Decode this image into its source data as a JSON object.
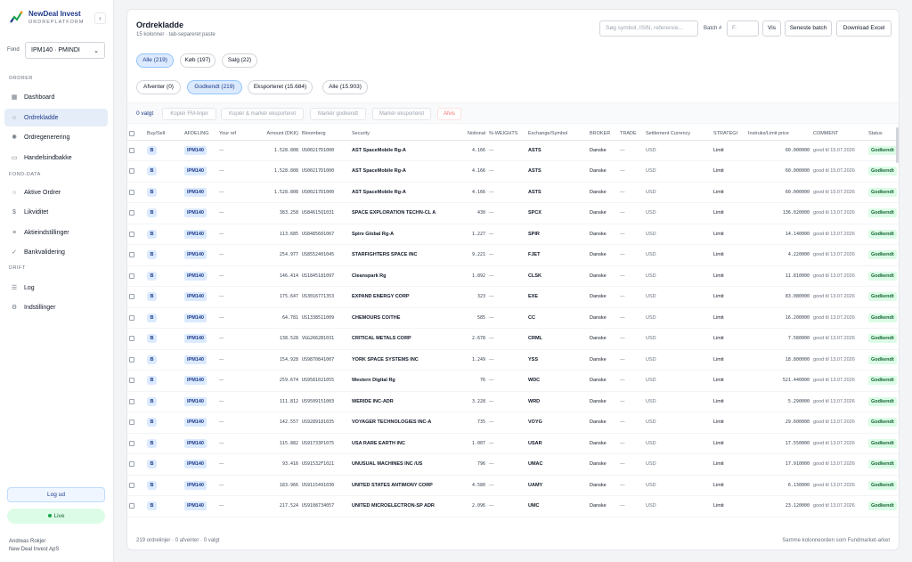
{
  "brand": {
    "name": "NewDeal Invest",
    "subtitle": "ORDREPLATFORM"
  },
  "sidebar": {
    "fond_label": "Fond",
    "fond_value": "IPM140 · PMINDI",
    "sections": [
      {
        "label": "ORDRER",
        "items": [
          {
            "label": "Dashboard",
            "icon": "grid-icon"
          },
          {
            "label": "Ordrekladde",
            "icon": "circle-icon",
            "active": true
          },
          {
            "label": "Ordregenerering",
            "icon": "sun-icon"
          },
          {
            "label": "Handelsindbakke",
            "icon": "inbox-icon"
          }
        ]
      },
      {
        "label": "FOND-DATA",
        "items": [
          {
            "label": "Aktive Ordrer",
            "icon": "circle-icon"
          },
          {
            "label": "Likviditet",
            "icon": "dollar-icon"
          },
          {
            "label": "Aktieindstillinger",
            "icon": "sliders-icon"
          },
          {
            "label": "Bankvalidering",
            "icon": "check-icon"
          }
        ]
      },
      {
        "label": "DRIFT",
        "items": [
          {
            "label": "Log",
            "icon": "list-icon"
          },
          {
            "label": "Indstillinger",
            "icon": "gear-icon"
          }
        ]
      }
    ],
    "logout_label": "Log ud",
    "live_label": "Live",
    "user_name": "Andreas Rokjer",
    "user_company": "New Deal Invest ApS"
  },
  "header": {
    "title": "Ordrekladde",
    "subtitle": "15 kolonner · tab-separeret paste",
    "search_placeholder": "Søg symbol, ISIN, reference...",
    "batch_label": "Batch #",
    "batch_placeholder": "F.",
    "vis_label": "Vis",
    "latest_batch_label": "Seneste batch",
    "download_label": "Download Excel"
  },
  "filters_side": [
    {
      "label": "Alle (219)",
      "active": true
    },
    {
      "label": "Køb (197)"
    },
    {
      "label": "Salg (22)"
    }
  ],
  "filters_status": [
    {
      "label": "Afventer (0)"
    },
    {
      "label": "Godkendt (219)",
      "active": true
    },
    {
      "label": "Eksporteret (15.684)"
    },
    {
      "label": "Alle (15.903)"
    }
  ],
  "actions": {
    "selected": "0 valgt",
    "copy_fm": "Kopiér FM-linjer",
    "copy_mark": "Kopiér & markér eksporteret",
    "mark_approved": "Markér godkendt",
    "mark_exported": "Markér eksporteret",
    "reject": "Afvis"
  },
  "columns": [
    "Buy/Sell",
    "AFDELING",
    "Your ref",
    "Amount (DKK)",
    "Bloomberg",
    "Security",
    "Notional",
    "%-WEIGHTS",
    "Exchange/Symbol",
    "BROKER",
    "TRADE",
    "Settlement Currency",
    "STRATEGI",
    "Instruks/Limit price",
    "COMMENT",
    "Status"
  ],
  "rows": [
    {
      "side": "B",
      "afd": "IPM140",
      "ref": "—",
      "amount": "1.528.808",
      "bbg": "US00217D1000",
      "sec": "AST SpaceMobile Rg-A",
      "notional": "4.166",
      "weights": "—",
      "sym": "ASTS",
      "broker": "Danske",
      "trade": "—",
      "ccy": "USD",
      "strat": "Limit",
      "limit": "60.000000",
      "comment": "good til 15.07.2026",
      "status": "Godkendt"
    },
    {
      "side": "B",
      "afd": "IPM140",
      "ref": "—",
      "amount": "1.528.808",
      "bbg": "US00217D1000",
      "sec": "AST SpaceMobile Rg-A",
      "notional": "4.166",
      "weights": "—",
      "sym": "ASTS",
      "broker": "Danske",
      "trade": "—",
      "ccy": "USD",
      "strat": "Limit",
      "limit": "60.000000",
      "comment": "good til 15.07.2026",
      "status": "Godkendt"
    },
    {
      "side": "B",
      "afd": "IPM140",
      "ref": "—",
      "amount": "1.528.808",
      "bbg": "US00217D1000",
      "sec": "AST SpaceMobile Rg-A",
      "notional": "4.166",
      "weights": "—",
      "sym": "ASTS",
      "broker": "Danske",
      "trade": "—",
      "ccy": "USD",
      "strat": "Limit",
      "limit": "60.000000",
      "comment": "good til 15.07.2026",
      "status": "Godkendt"
    },
    {
      "side": "B",
      "afd": "IPM140",
      "ref": "—",
      "amount": "383.258",
      "bbg": "US84615Q1031",
      "sec": "SPACE EXPLORATION TECHN-CL A",
      "notional": "430",
      "weights": "—",
      "sym": "SPCX",
      "broker": "Danske",
      "trade": "—",
      "ccy": "USD",
      "strat": "Limit",
      "limit": "136.020000",
      "comment": "good til 13.07.2026",
      "status": "Godkendt"
    },
    {
      "side": "B",
      "afd": "IPM140",
      "ref": "—",
      "amount": "113.685",
      "bbg": "US8485601067",
      "sec": "Spire Global Rg-A",
      "notional": "1.227",
      "weights": "—",
      "sym": "SPIR",
      "broker": "Danske",
      "trade": "—",
      "ccy": "USD",
      "strat": "Limit",
      "limit": "14.140000",
      "comment": "good til 13.07.2026",
      "status": "Godkendt"
    },
    {
      "side": "B",
      "afd": "IPM140",
      "ref": "—",
      "amount": "254.977",
      "bbg": "US8552401045",
      "sec": "STARFIGHTERS SPACE INC",
      "notional": "9.221",
      "weights": "—",
      "sym": "FJET",
      "broker": "Danske",
      "trade": "—",
      "ccy": "USD",
      "strat": "Limit",
      "limit": "4.220000",
      "comment": "good til 13.07.2026",
      "status": "Godkendt"
    },
    {
      "side": "B",
      "afd": "IPM140",
      "ref": "—",
      "amount": "146.414",
      "bbg": "US1845181097",
      "sec": "Cleanspark Rg",
      "notional": "1.892",
      "weights": "—",
      "sym": "CLSK",
      "broker": "Danske",
      "trade": "—",
      "ccy": "USD",
      "strat": "Limit",
      "limit": "11.810000",
      "comment": "good til 13.07.2026",
      "status": "Godkendt"
    },
    {
      "side": "B",
      "afd": "IPM140",
      "ref": "—",
      "amount": "175.647",
      "bbg": "US3016771353",
      "sec": "EXPAND ENERGY CORP",
      "notional": "323",
      "weights": "—",
      "sym": "EXE",
      "broker": "Danske",
      "trade": "—",
      "ccy": "USD",
      "strat": "Limit",
      "limit": "83.080000",
      "comment": "good til 13.07.2026",
      "status": "Godkendt"
    },
    {
      "side": "B",
      "afd": "IPM140",
      "ref": "—",
      "amount": "64.781",
      "bbg": "US1338511009",
      "sec": "CHEMOURS CO/THE",
      "notional": "585",
      "weights": "—",
      "sym": "CC",
      "broker": "Danske",
      "trade": "—",
      "ccy": "USD",
      "strat": "Limit",
      "limit": "16.200000",
      "comment": "good til 13.07.2026",
      "status": "Godkendt"
    },
    {
      "side": "B",
      "afd": "IPM140",
      "ref": "—",
      "amount": "138.528",
      "bbg": "VGG2662B1031",
      "sec": "CRITICAL METALS CORP",
      "notional": "2.678",
      "weights": "—",
      "sym": "CRML",
      "broker": "Danske",
      "trade": "—",
      "ccy": "USD",
      "strat": "Limit",
      "limit": "7.580000",
      "comment": "good til 13.07.2026",
      "status": "Godkendt"
    },
    {
      "side": "B",
      "afd": "IPM140",
      "ref": "—",
      "amount": "154.928",
      "bbg": "US9870841007",
      "sec": "YORK SPACE SYSTEMS INC",
      "notional": "1.249",
      "weights": "—",
      "sym": "YSS",
      "broker": "Danske",
      "trade": "—",
      "ccy": "USD",
      "strat": "Limit",
      "limit": "18.800000",
      "comment": "good til 13.07.2026",
      "status": "Godkendt"
    },
    {
      "side": "B",
      "afd": "IPM140",
      "ref": "—",
      "amount": "259.674",
      "bbg": "US9581021055",
      "sec": "Western Digital Rg",
      "notional": "76",
      "weights": "—",
      "sym": "WDC",
      "broker": "Danske",
      "trade": "—",
      "ccy": "USD",
      "strat": "Limit",
      "limit": "521.440000",
      "comment": "good til 13.07.2026",
      "status": "Godkendt"
    },
    {
      "side": "B",
      "afd": "IPM140",
      "ref": "—",
      "amount": "111.812",
      "bbg": "US9509151003",
      "sec": "WERIDE INC-ADR",
      "notional": "3.228",
      "weights": "—",
      "sym": "WRD",
      "broker": "Danske",
      "trade": "—",
      "ccy": "USD",
      "strat": "Limit",
      "limit": "5.290000",
      "comment": "good til 13.07.2026",
      "status": "Godkendt"
    },
    {
      "side": "B",
      "afd": "IPM140",
      "ref": "—",
      "amount": "142.557",
      "bbg": "US9289181035",
      "sec": "VOYAGER TECHNOLOGIES INC-A",
      "notional": "735",
      "weights": "—",
      "sym": "VOYG",
      "broker": "Danske",
      "trade": "—",
      "ccy": "USD",
      "strat": "Limit",
      "limit": "29.600000",
      "comment": "good til 13.07.2026",
      "status": "Godkendt"
    },
    {
      "side": "B",
      "afd": "IPM140",
      "ref": "—",
      "amount": "115.882",
      "bbg": "US91733P1075",
      "sec": "USA RARE EARTH INC",
      "notional": "1.007",
      "weights": "—",
      "sym": "USAR",
      "broker": "Danske",
      "trade": "—",
      "ccy": "USD",
      "strat": "Limit",
      "limit": "17.550000",
      "comment": "good til 13.07.2026",
      "status": "Godkendt"
    },
    {
      "side": "B",
      "afd": "IPM140",
      "ref": "—",
      "amount": "93.416",
      "bbg": "US91532F1021",
      "sec": "UNUSUAL MACHINES INC /US",
      "notional": "796",
      "weights": "—",
      "sym": "UMAC",
      "broker": "Danske",
      "trade": "—",
      "ccy": "USD",
      "strat": "Limit",
      "limit": "17.910000",
      "comment": "good til 13.07.2026",
      "status": "Godkendt"
    },
    {
      "side": "B",
      "afd": "IPM140",
      "ref": "—",
      "amount": "183.966",
      "bbg": "US9115491030",
      "sec": "UNITED STATES ANTIMONY CORP",
      "notional": "4.580",
      "weights": "—",
      "sym": "UAMY",
      "broker": "Danske",
      "trade": "—",
      "ccy": "USD",
      "strat": "Limit",
      "limit": "6.130000",
      "comment": "good til 13.07.2026",
      "status": "Godkendt"
    },
    {
      "side": "B",
      "afd": "IPM140",
      "ref": "—",
      "amount": "217.524",
      "bbg": "US9108734057",
      "sec": "UNITED MICROELECTRON-SP ADR",
      "notional": "2.096",
      "weights": "—",
      "sym": "UMC",
      "broker": "Danske",
      "trade": "—",
      "ccy": "USD",
      "strat": "Limit",
      "limit": "23.120000",
      "comment": "good til 13.07.2026",
      "status": "Godkendt"
    }
  ],
  "footer": {
    "left": "219 ordrelinjer · 0 afventer · 0 valgt",
    "right": "Samme kolonneorden som Fundmarket-arket"
  }
}
